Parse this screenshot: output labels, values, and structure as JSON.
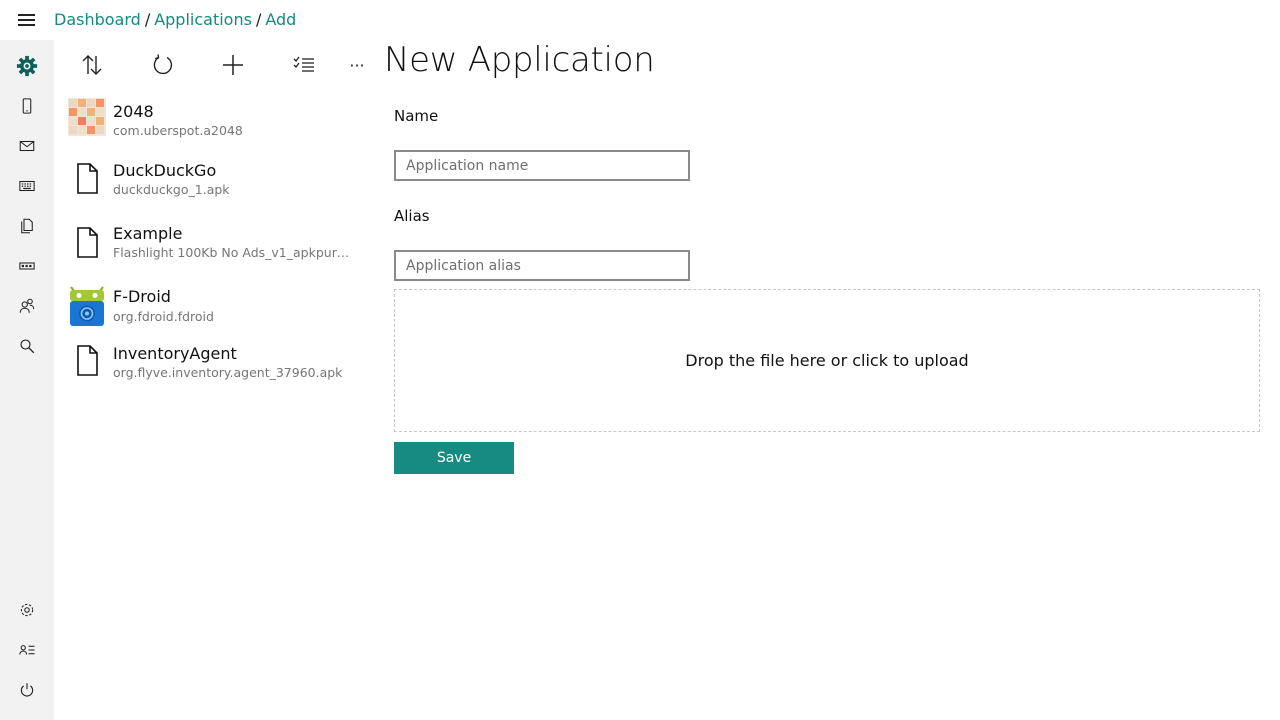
{
  "breadcrumb": {
    "item1": "Dashboard",
    "item2": "Applications",
    "item3": "Add",
    "separator": "/"
  },
  "accent_color": "#178a82",
  "rail": {
    "top_items": [
      "logo-gear-icon",
      "device-icon",
      "mail-icon",
      "keyboard-icon",
      "files-icon",
      "fleet-icon",
      "users-icon",
      "search-icon"
    ],
    "bottom_items": [
      "settings-icon",
      "profile-list-icon",
      "power-icon"
    ]
  },
  "toolbar": {
    "sort": "sort-icon",
    "refresh": "refresh-icon",
    "add": "add-icon",
    "select": "multi-select-icon",
    "more_label": "···"
  },
  "page_title": "New Application",
  "apps": [
    {
      "name": "2048",
      "sub": "com.uberspot.a2048",
      "icon": "app-2048-icon"
    },
    {
      "name": "DuckDuckGo",
      "sub": "duckduckgo_1.apk",
      "icon": "file-icon"
    },
    {
      "name": "Example",
      "sub": "Flashlight 100Kb No Ads_v1_apkpure.co...",
      "icon": "file-icon"
    },
    {
      "name": "F-Droid",
      "sub": "org.fdroid.fdroid",
      "icon": "fdroid-icon"
    },
    {
      "name": "InventoryAgent",
      "sub": "org.flyve.inventory.agent_37960.apk",
      "icon": "file-icon"
    }
  ],
  "form": {
    "name_label": "Name",
    "name_placeholder": "Application name",
    "name_value": "",
    "alias_label": "Alias",
    "alias_placeholder": "Application alias",
    "alias_value": "",
    "dropzone_text": "Drop the file here or click to upload",
    "save_label": "Save"
  }
}
